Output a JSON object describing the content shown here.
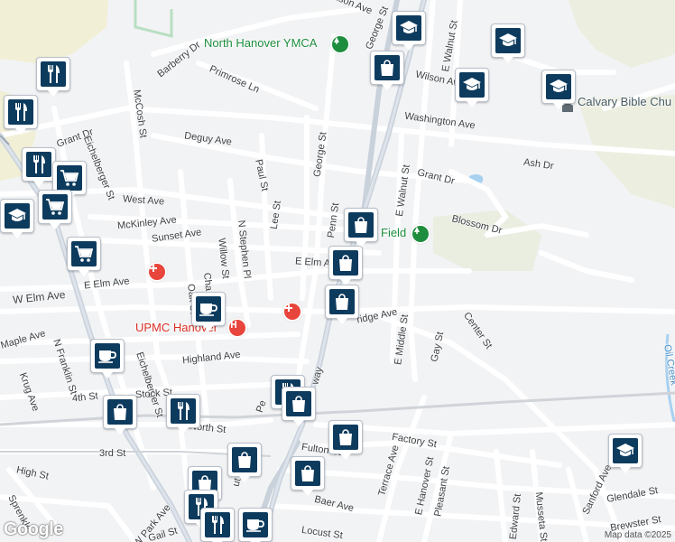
{
  "map": {
    "attribution": "Map data ©2025",
    "logo": "Google",
    "streets": [
      {
        "id": "s1",
        "label": "Wilson Ave"
      },
      {
        "id": "s2",
        "label": "E Walnut St"
      },
      {
        "id": "s3",
        "label": "George St"
      },
      {
        "id": "s4",
        "label": "Barberry Dr"
      },
      {
        "id": "s5",
        "label": "Primrose Ln"
      },
      {
        "id": "s6",
        "label": "McCosh St"
      },
      {
        "id": "s7",
        "label": "Grant Dr"
      },
      {
        "id": "s8",
        "label": "Eichelberger St"
      },
      {
        "id": "s9",
        "label": "Deguy Ave"
      },
      {
        "id": "s10",
        "label": "Washington Ave"
      },
      {
        "id": "s11",
        "label": "Ash Dr"
      },
      {
        "id": "s12",
        "label": "George St"
      },
      {
        "id": "s13",
        "label": "Paul St"
      },
      {
        "id": "s14",
        "label": "Grant Dr"
      },
      {
        "id": "s15",
        "label": "E Walnut St"
      },
      {
        "id": "s16",
        "label": "West Ave"
      },
      {
        "id": "s17",
        "label": "Lee St"
      },
      {
        "id": "s18",
        "label": "Penn St"
      },
      {
        "id": "s19",
        "label": "McKinley Ave"
      },
      {
        "id": "s20",
        "label": "Blossom Dr"
      },
      {
        "id": "s21",
        "label": "Sunset Ave"
      },
      {
        "id": "s22",
        "label": "N Stephen Pl"
      },
      {
        "id": "s23",
        "label": "E Elm Ave"
      },
      {
        "id": "s24",
        "label": "E Elm Ave"
      },
      {
        "id": "s25",
        "label": "Willow St"
      },
      {
        "id": "s26",
        "label": "W Elm Ave"
      },
      {
        "id": "s27",
        "label": "Oak St"
      },
      {
        "id": "s28",
        "label": "Cha"
      },
      {
        "id": "s29",
        "label": "Maple Ave"
      },
      {
        "id": "s30",
        "label": "ridge Ave"
      },
      {
        "id": "s31",
        "label": "E Middle St"
      },
      {
        "id": "s32",
        "label": "Center St"
      },
      {
        "id": "s33",
        "label": "N Franklin St"
      },
      {
        "id": "s34",
        "label": "Highland Ave"
      },
      {
        "id": "s35",
        "label": "Gay St"
      },
      {
        "id": "s36",
        "label": "Krug Ave"
      },
      {
        "id": "s37",
        "label": "Eichelberger St"
      },
      {
        "id": "s38",
        "label": "4th St"
      },
      {
        "id": "s39",
        "label": "Stock St"
      },
      {
        "id": "s40",
        "label": "Pe"
      },
      {
        "id": "s41",
        "label": "way"
      },
      {
        "id": "s42",
        "label": "North St"
      },
      {
        "id": "s43",
        "label": "3rd St"
      },
      {
        "id": "s44",
        "label": "Fulton St"
      },
      {
        "id": "s45",
        "label": "Factory St"
      },
      {
        "id": "s46",
        "label": "High St"
      },
      {
        "id": "s47",
        "label": "Terrace Ave"
      },
      {
        "id": "s48",
        "label": "E Hanover St"
      },
      {
        "id": "s49",
        "label": "Pleasant St"
      },
      {
        "id": "s50",
        "label": "Sanford Ave"
      },
      {
        "id": "s51",
        "label": "Sprenkle"
      },
      {
        "id": "s52",
        "label": "Baer Ave"
      },
      {
        "id": "s53",
        "label": "Edward St"
      },
      {
        "id": "s54",
        "label": "Musseta St"
      },
      {
        "id": "s55",
        "label": "Glendale St"
      },
      {
        "id": "s56",
        "label": "Brewster St"
      },
      {
        "id": "s57",
        "label": "W Park Ave"
      },
      {
        "id": "s58",
        "label": "Gail St"
      },
      {
        "id": "s59",
        "label": "Locust St"
      },
      {
        "id": "s60",
        "label": "nison Ave"
      },
      {
        "id": "s61",
        "label": "Oil Creek"
      },
      {
        "id": "s62",
        "label": "ut"
      }
    ],
    "places": [
      {
        "id": "p1",
        "label": "North Hanover YMCA",
        "color": "#1e8e3e"
      },
      {
        "id": "p2",
        "label": "Calvary Bible Chu",
        "color": "#455a64"
      },
      {
        "id": "p3",
        "label": "Field",
        "color": "#1e8e3e"
      },
      {
        "id": "p4",
        "label": "UPMC Hanover",
        "color": "#d93025"
      }
    ],
    "markers": [
      {
        "id": "m1",
        "icon": "school-icon"
      },
      {
        "id": "m2",
        "icon": "school-icon"
      },
      {
        "id": "m3",
        "icon": "shopping-bag-icon"
      },
      {
        "id": "m4",
        "icon": "school-icon"
      },
      {
        "id": "m5",
        "icon": "school-icon"
      },
      {
        "id": "m6",
        "icon": "restaurant-icon"
      },
      {
        "id": "m7",
        "icon": "restaurant-icon"
      },
      {
        "id": "m8",
        "icon": "restaurant-icon"
      },
      {
        "id": "m9",
        "icon": "grocery-cart-icon"
      },
      {
        "id": "m10",
        "icon": "school-icon"
      },
      {
        "id": "m11",
        "icon": "grocery-cart-icon"
      },
      {
        "id": "m12",
        "icon": "grocery-cart-icon"
      },
      {
        "id": "m13",
        "icon": "shopping-bag-icon"
      },
      {
        "id": "m14",
        "icon": "shopping-bag-icon"
      },
      {
        "id": "m15",
        "icon": "coffee-cup-icon"
      },
      {
        "id": "m16",
        "icon": "shopping-bag-icon"
      },
      {
        "id": "m17",
        "icon": "coffee-cup-icon"
      },
      {
        "id": "m18",
        "icon": "restaurant-icon"
      },
      {
        "id": "m19",
        "icon": "shopping-bag-icon"
      },
      {
        "id": "m20",
        "icon": "restaurant-icon"
      },
      {
        "id": "m21",
        "icon": "shopping-bag-icon"
      },
      {
        "id": "m22",
        "icon": "shopping-bag-icon"
      },
      {
        "id": "m23",
        "icon": "shopping-bag-icon"
      },
      {
        "id": "m24",
        "icon": "shopping-bag-icon"
      },
      {
        "id": "m25",
        "icon": "school-icon"
      },
      {
        "id": "m26",
        "icon": "shopping-bag-icon"
      },
      {
        "id": "m27",
        "icon": "restaurant-icon"
      },
      {
        "id": "m28",
        "icon": "restaurant-icon"
      },
      {
        "id": "m29",
        "icon": "coffee-cup-icon"
      }
    ]
  }
}
